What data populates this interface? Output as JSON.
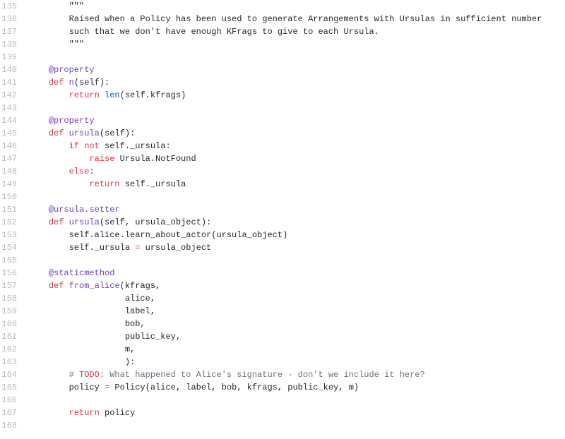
{
  "tokens": {
    "triquote": "\"\"\"",
    "at": "@",
    "property": "property",
    "def": "def",
    "return": "return",
    "len": "len",
    "self": "self",
    "if": "if",
    "not": "not",
    "raise": "raise",
    "else": "else",
    "setter": "setter",
    "staticmethod": "staticmethod"
  },
  "docstring": {
    "l1": "Raised when a Policy has been used to generate Arrangements with Ursulas in sufficient number",
    "l2": "such that we don't have enough KFrags to give to each Ursula."
  },
  "fn_n": {
    "name": "n",
    "ret_prefix": "(",
    "kfrags": ".kfrags)"
  },
  "fn_ursula": {
    "name": "ursula",
    "attr": "._ursula",
    "colon": ":",
    "raise_expr": "Ursula.NotFound",
    "ret_attr": "._ursula"
  },
  "fn_setter": {
    "signame": "ursula",
    "args": "(self, ursula_object):",
    "l1_pre": ".alice.learn_about_actor(ursula_object)",
    "l2_pre": "._ursula ",
    "l2_eq": "=",
    "l2_post": " ursula_object"
  },
  "fn_from_alice": {
    "name": "from_alice",
    "a1": "(kfrags,",
    "a2": "alice,",
    "a3": "label,",
    "a4": "bob,",
    "a5": "public_key,",
    "a6": "m,",
    "a7": "):"
  },
  "todo": {
    "hash": "# ",
    "label": "TODO",
    "rest": ": What happened to Alice's signature - don't we include it here?"
  },
  "policy_line": {
    "var": "policy ",
    "eq": "=",
    "call": " Policy(alice, label, bob, kfrags, public_key, m)"
  },
  "return_policy": " policy",
  "lines": {
    "135": "135",
    "136": "136",
    "137": "137",
    "138": "138",
    "139": "139",
    "140": "140",
    "141": "141",
    "142": "142",
    "143": "143",
    "144": "144",
    "145": "145",
    "146": "146",
    "147": "147",
    "148": "148",
    "149": "149",
    "150": "150",
    "151": "151",
    "152": "152",
    "153": "153",
    "154": "154",
    "155": "155",
    "156": "156",
    "157": "157",
    "158": "158",
    "159": "159",
    "160": "160",
    "161": "161",
    "162": "162",
    "163": "163",
    "164": "164",
    "165": "165",
    "166": "166",
    "167": "167",
    "168": "168"
  }
}
